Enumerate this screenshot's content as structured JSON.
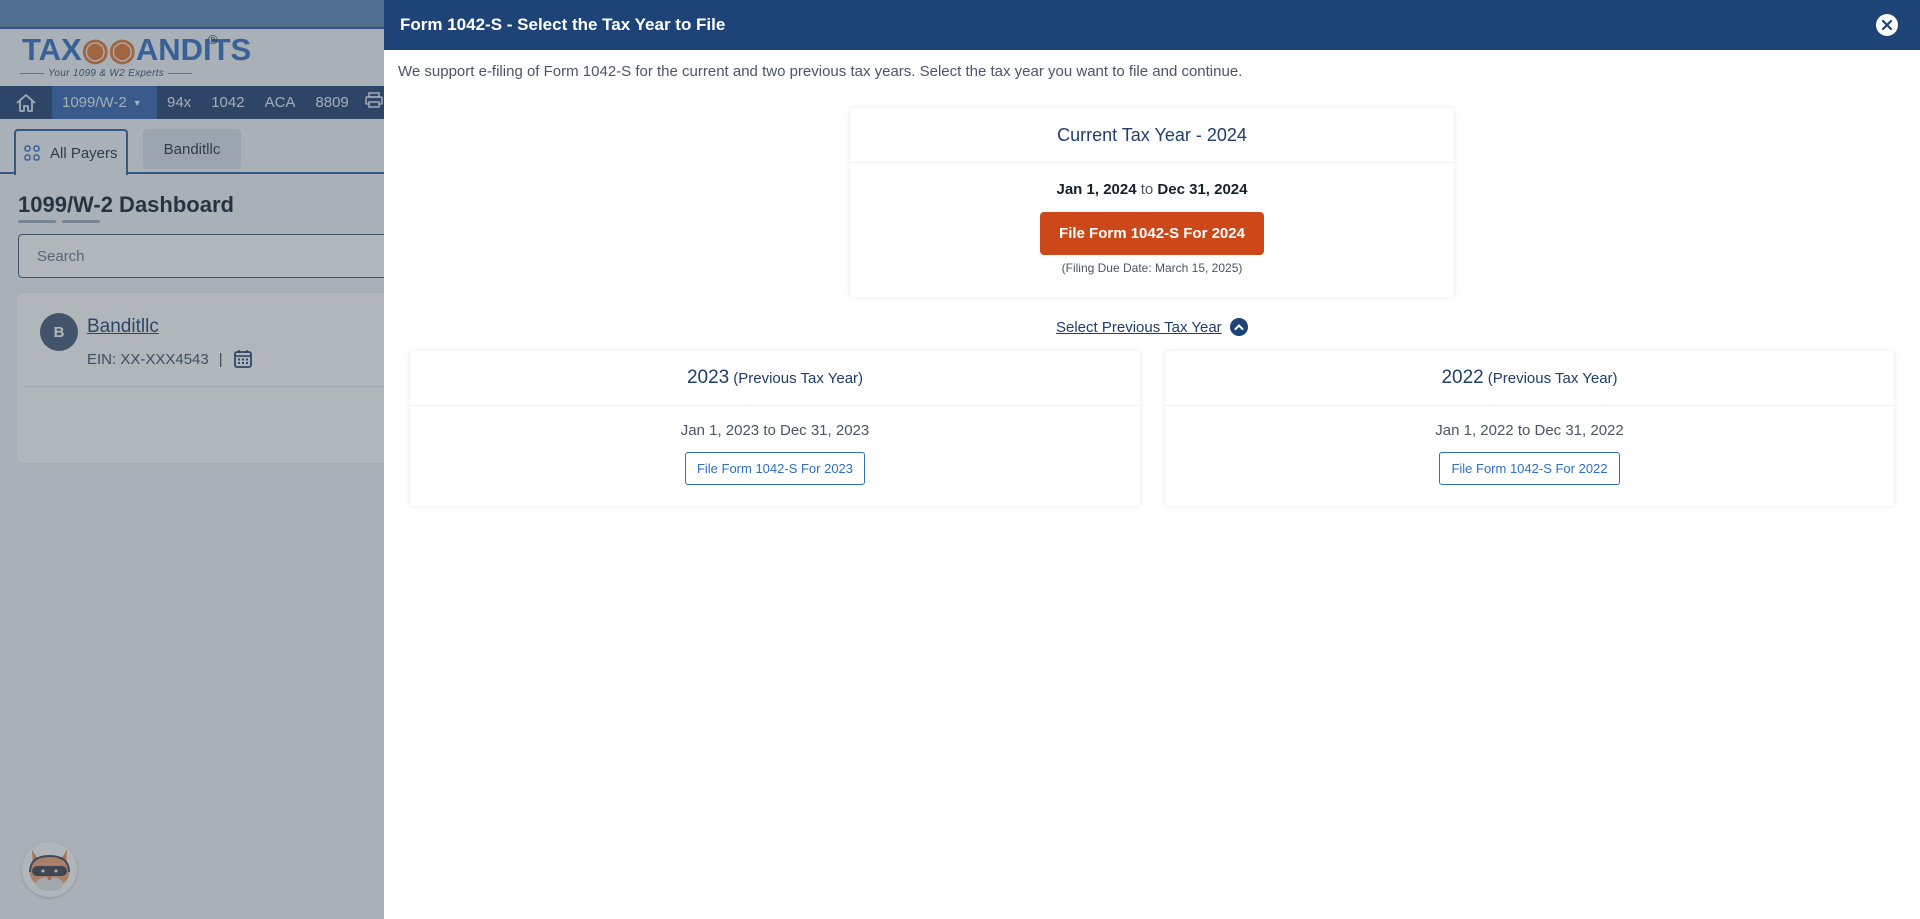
{
  "background": {
    "logo": {
      "brand": "TAXBANDITS",
      "registered": "®",
      "tagline": "Your 1099 & W2 Experts"
    },
    "nav": {
      "home_icon": "home-icon",
      "items": [
        {
          "label": "1099/W-2",
          "active": true,
          "has_caret": true
        },
        {
          "label": "94x"
        },
        {
          "label": "1042"
        },
        {
          "label": "ACA"
        },
        {
          "label": "8809"
        }
      ],
      "print_icon": "printer-icon"
    },
    "tabs": {
      "all_payers": "All Payers",
      "payer_tab": "Banditllc"
    },
    "dashboard_title": "1099/W-2 Dashboard",
    "search": {
      "placeholder": "Search",
      "value": ""
    },
    "payer": {
      "avatar_letter": "B",
      "name": "Banditllc",
      "ein": "EIN: XX-XXX4543",
      "separator": "|"
    }
  },
  "drawer": {
    "title": "Form 1042-S - Select the Tax Year to File",
    "intro": "We support e-filing of Form 1042-S for the current and two previous tax years. Select the tax year you want to file and continue.",
    "current": {
      "heading": "Current Tax Year - 2024",
      "start": "Jan 1, 2024",
      "to": "to",
      "end": "Dec 31, 2024",
      "button": "File Form 1042-S For 2024",
      "due": "(Filing Due Date: March 15, 2025)"
    },
    "previous_toggle": "Select Previous Tax Year",
    "previous": [
      {
        "year": "2023",
        "label": "(Previous Tax Year)",
        "range": "Jan 1, 2023 to Dec 31, 2023",
        "button": "File Form 1042-S For 2023"
      },
      {
        "year": "2022",
        "label": "(Previous Tax Year)",
        "range": "Jan 1, 2022 to Dec 31, 2022",
        "button": "File Form 1042-S For 2022"
      }
    ]
  },
  "colors": {
    "header": "#1e4477",
    "primary_button": "#cc4818",
    "link_blue": "#2f6ec1"
  }
}
